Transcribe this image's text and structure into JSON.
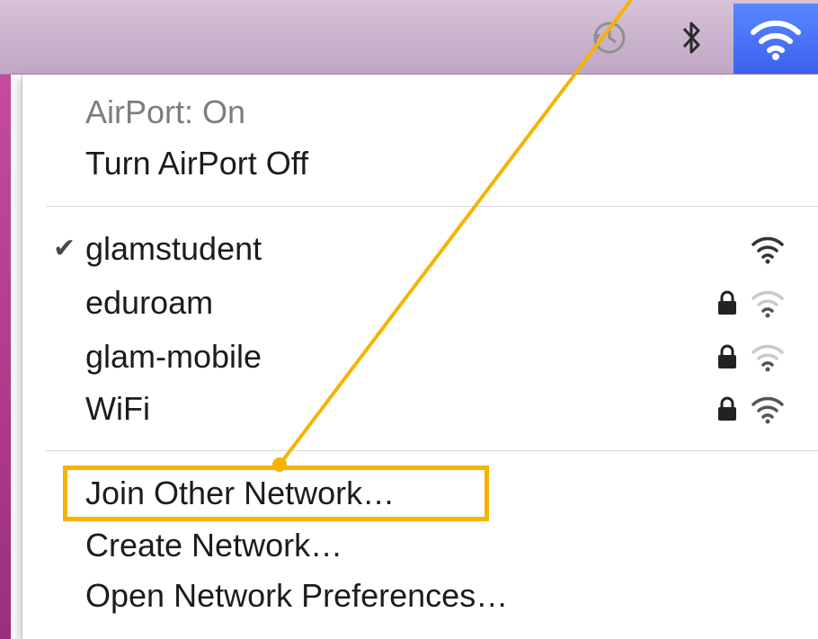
{
  "menubar": {
    "icons": [
      "time-machine-icon",
      "bluetooth-icon",
      "wifi-icon"
    ],
    "active_color": "#3b62ee"
  },
  "menu": {
    "status": "AirPort: On",
    "toggle": "Turn AirPort Off",
    "networks": [
      {
        "name": "glamstudent",
        "selected": true,
        "locked": false,
        "signal": "full"
      },
      {
        "name": "eduroam",
        "selected": false,
        "locked": true,
        "signal": "weak"
      },
      {
        "name": "glam-mobile",
        "selected": false,
        "locked": true,
        "signal": "weak"
      },
      {
        "name": "WiFi",
        "selected": false,
        "locked": true,
        "signal": "full"
      }
    ],
    "join_other": "Join Other Network…",
    "create": "Create Network…",
    "open_prefs": "Open Network Preferences…"
  },
  "annotation": {
    "highlight_color": "#f4b400"
  }
}
